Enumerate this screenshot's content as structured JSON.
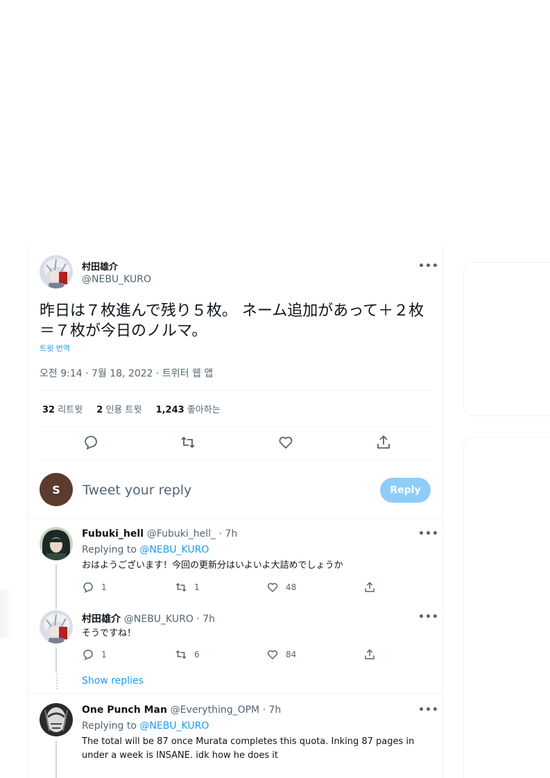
{
  "main_tweet": {
    "author_name": "村田雄介",
    "handle": "@NEBU_KURO",
    "text": "昨日は７枚進んで残り５枚。 ネーム追加があって＋２枚＝７枚が今日のノルマ。",
    "translate_link": "트윗 번역",
    "timestamp": "오전 9:14 · 7월 18, 2022 · 트위터 웹 앱",
    "stats": {
      "retweets_count": "32",
      "retweets_label": "리트윗",
      "quotes_count": "2",
      "quotes_label": "인용 트윗",
      "likes_count": "1,243",
      "likes_label": "좋아하는"
    }
  },
  "composer": {
    "avatar_letter": "S",
    "placeholder": "Tweet your reply",
    "reply_button": "Reply"
  },
  "replies": [
    {
      "name": "Fubuki_hell",
      "meta": "@Fubuki_hell_ · 7h",
      "replying_prefix": "Replying to",
      "replying_to": "@NEBU_KURO",
      "text": "おはようございます！今回の更新分はいよいよ大詰めでしょうか",
      "reply_count": "1",
      "retweet_count": "1",
      "like_count": "48"
    },
    {
      "name": "村田雄介",
      "meta": "@NEBU_KURO · 7h",
      "text": "そうですね！",
      "reply_count": "1",
      "retweet_count": "6",
      "like_count": "84"
    },
    {
      "name": "One Punch Man",
      "meta": "@Everything_OPM · 7h",
      "replying_prefix": "Replying to",
      "replying_to": "@NEBU_KURO",
      "text": "The total will be 87 once Murata completes this quota. Inking 87 pages in under a week is INSANE. idk how he does it"
    }
  ],
  "show_replies": "Show replies",
  "colors": {
    "accent": "#1d9bf0",
    "muted": "#536471",
    "reply_button_bg": "#8ecdf8",
    "composer_avatar_bg": "#5c3a2e"
  }
}
